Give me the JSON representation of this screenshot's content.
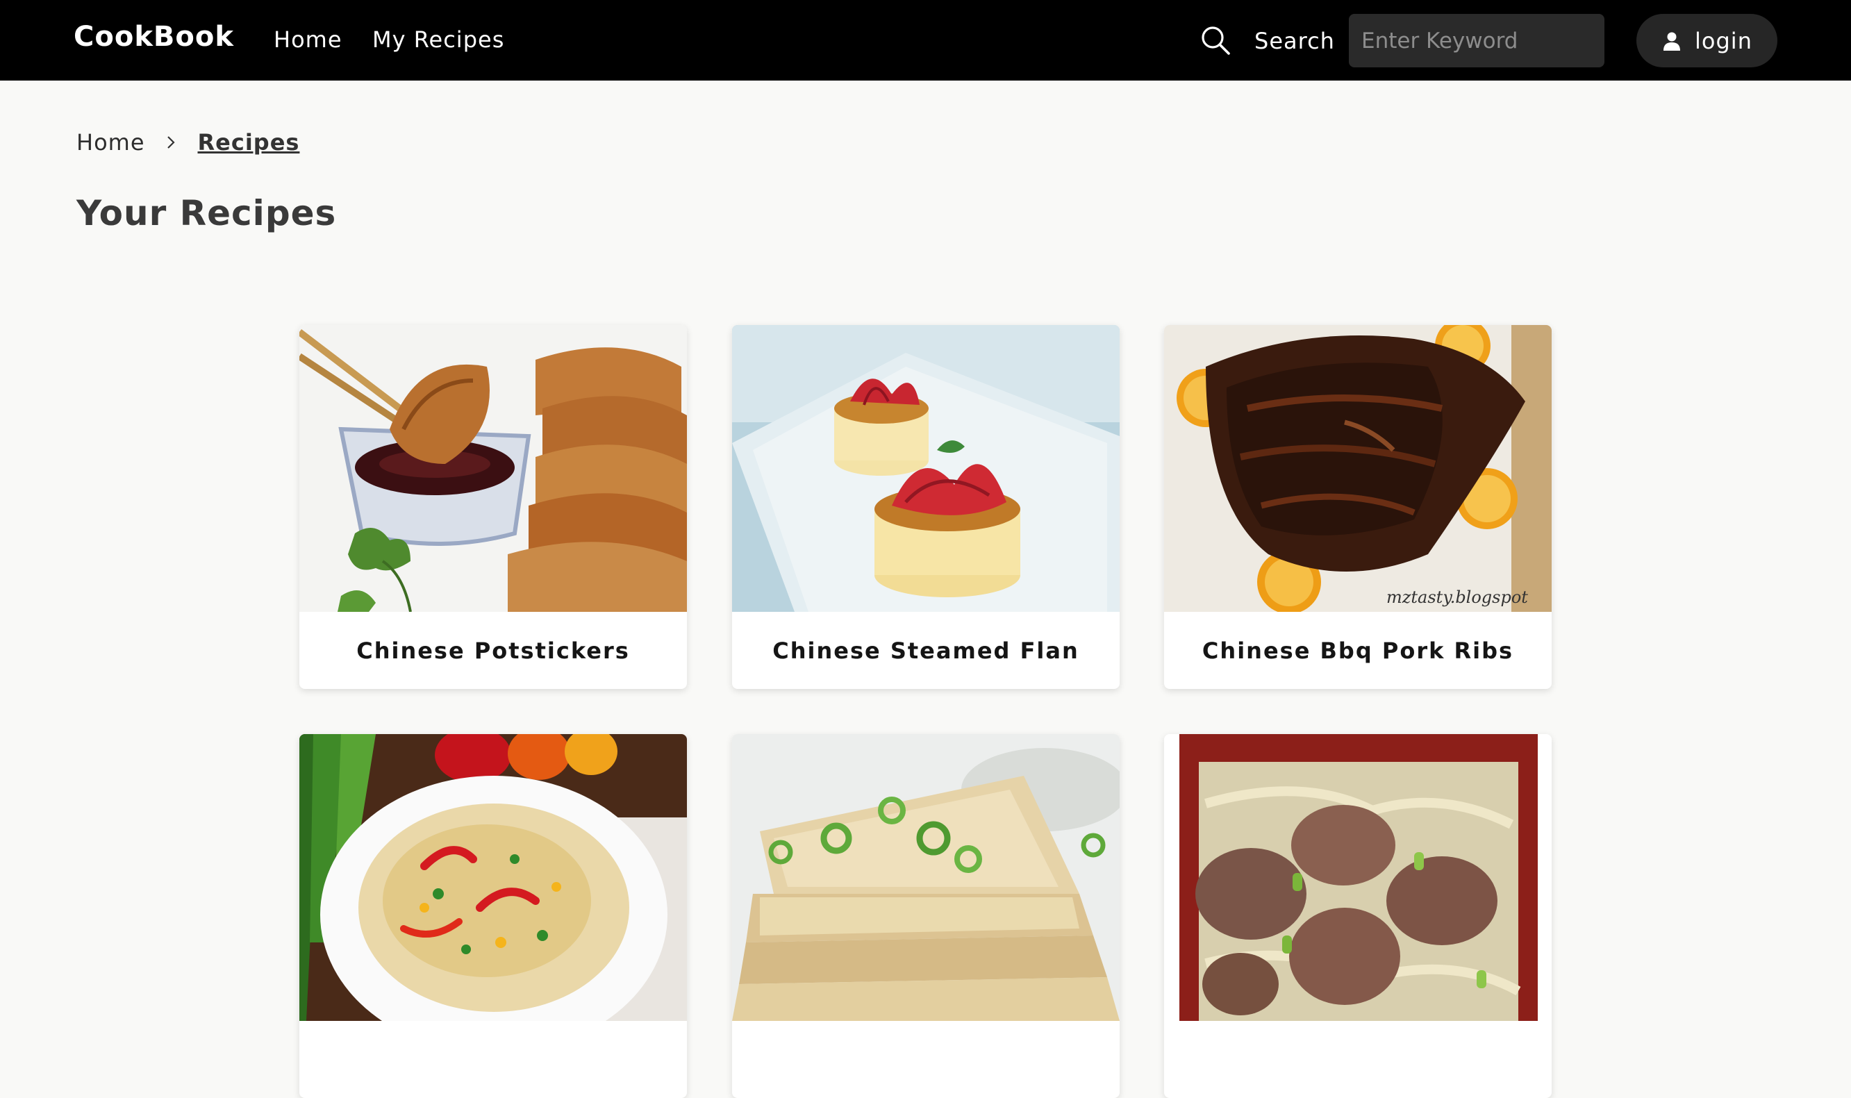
{
  "navbar": {
    "brand": "CookBook",
    "links": [
      {
        "label": "Home"
      },
      {
        "label": "My Recipes"
      }
    ],
    "search_label": "Search",
    "search_placeholder": "Enter Keyword",
    "login_label": "login",
    "icons": {
      "search": "search-icon",
      "user": "user-icon"
    }
  },
  "breadcrumb": {
    "home": "Home",
    "current": "Recipes",
    "separator_icon": "chevron-right-icon"
  },
  "page_title": "Your Recipes",
  "recipes": [
    {
      "title": "Chinese Potstickers",
      "image": "potstickers-image"
    },
    {
      "title": "Chinese Steamed Flan",
      "image": "steamed-flan-image"
    },
    {
      "title": "Chinese Bbq Pork Ribs",
      "image": "bbq-pork-ribs-image",
      "image_watermark": "mztasty.blogspot"
    },
    {
      "title": "",
      "image": "fried-rice-image"
    },
    {
      "title": "",
      "image": "scallion-pancakes-image"
    },
    {
      "title": "",
      "image": "meatballs-cabbage-image"
    }
  ],
  "colors": {
    "navbar_bg": "#000000",
    "page_bg": "#f9f9f7",
    "card_bg": "#ffffff",
    "input_bg": "#2a2a2a",
    "login_bg": "#262626"
  }
}
